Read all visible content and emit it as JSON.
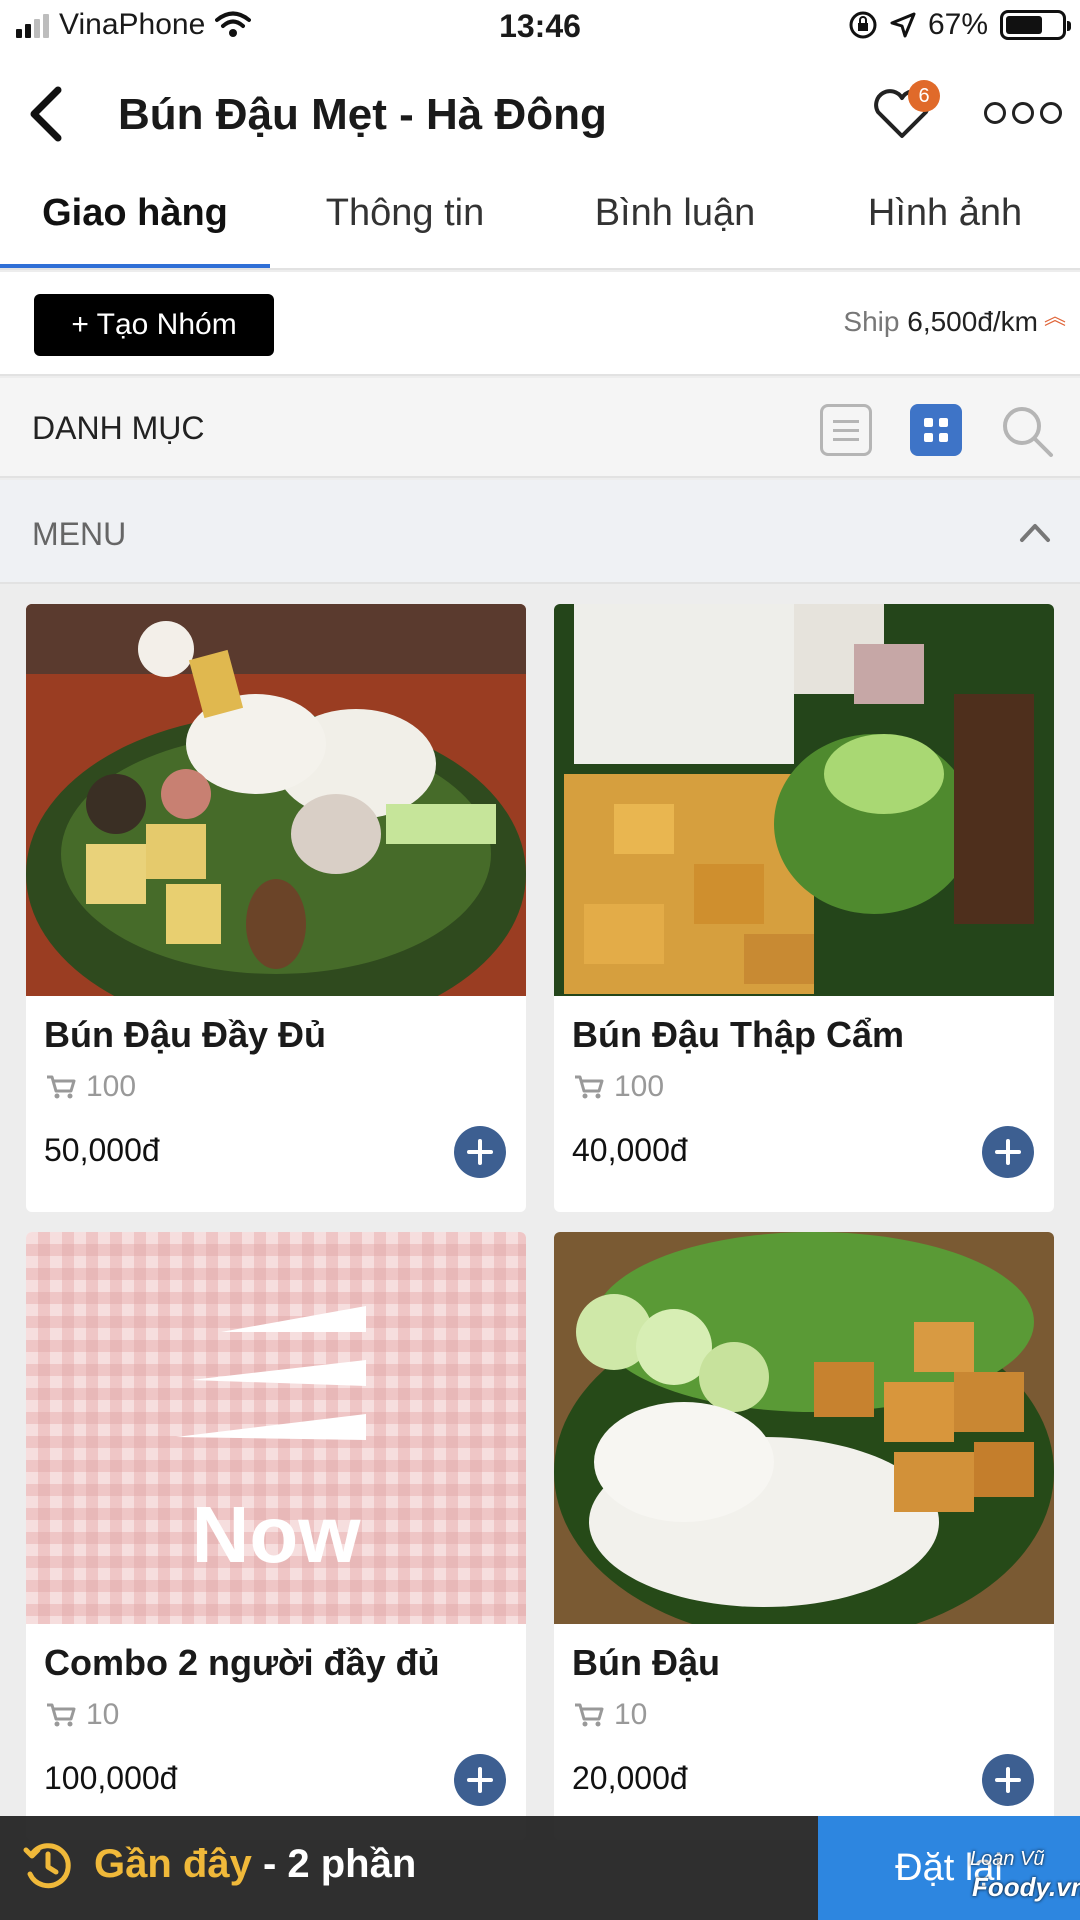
{
  "status_bar": {
    "carrier": "VinaPhone",
    "time": "13:46",
    "battery": "67%"
  },
  "header": {
    "title": "Bún Đậu Mẹt - Hà Đông",
    "favorites_badge": "6"
  },
  "tabs": [
    {
      "label": "Giao hàng",
      "active": true
    },
    {
      "label": "Thông tin",
      "active": false
    },
    {
      "label": "Bình luận",
      "active": false
    },
    {
      "label": "Hình ảnh",
      "active": false
    }
  ],
  "group": {
    "button_label": "+ Tạo Nhóm",
    "ship_label": "Ship",
    "ship_value": "6,500đ/km"
  },
  "category": {
    "label": "DANH MỤC"
  },
  "menu_section": {
    "label": "MENU"
  },
  "items": [
    {
      "name": "Bún Đậu Đầy Đủ",
      "sold": "100",
      "price": "50,000đ"
    },
    {
      "name": "Bún Đậu Thập Cẩm",
      "sold": "100",
      "price": "40,000đ"
    },
    {
      "name": "Combo 2 người đầy đủ",
      "sold": "10",
      "price": "100,000đ",
      "image_text": "Now"
    },
    {
      "name": "Bún Đậu",
      "sold": "10",
      "price": "20,000đ"
    }
  ],
  "bottom": {
    "recent_label": "Gần đây",
    "recent_count": " - 2 phần",
    "reorder_label": "Đặt lại"
  },
  "watermark": {
    "author": "Loan Vũ",
    "brand": "Foody.vn"
  },
  "colors": {
    "accent_blue": "#2d86e0",
    "tab_underline": "#2f6fd6",
    "add_button": "#3d5f91",
    "badge": "#e06a2a",
    "recent_accent": "#f0b93a"
  }
}
